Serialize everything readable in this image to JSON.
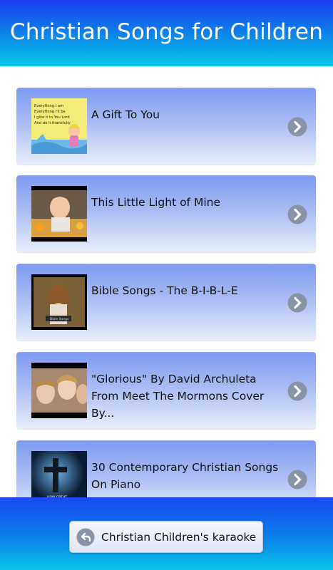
{
  "app": {
    "title": "Christian Songs for Children"
  },
  "songs": [
    {
      "title": "A Gift To You",
      "thumbnail_text": "Everything I am\nEverything I'll be\nI give it to You Lord\nAnd do it thankfully"
    },
    {
      "title": "This Little Light of Mine"
    },
    {
      "title": "Bible Songs - The B-I-B-L-E",
      "thumbnail_text": "Bible Songs"
    },
    {
      "title": "\"Glorious\" By David Archuleta From Meet The Mormons Cover By..."
    },
    {
      "title": "30 Contemporary Christian Songs On Piano",
      "thumbnail_text": "HOW GREAT\nIS OUR GOD"
    }
  ],
  "footer": {
    "karaoke_label": "Christian Children's karaoke"
  },
  "icons": {
    "item_chevron": "chevron-right-icon",
    "karaoke_button": "back-arrow-icon"
  },
  "colors": {
    "header_top": "#1a3cf0",
    "header_bottom": "#08c8e6",
    "card_top": "#7f9af2",
    "card_bottom": "#e9eefb",
    "chevron": "#8a93a6"
  }
}
